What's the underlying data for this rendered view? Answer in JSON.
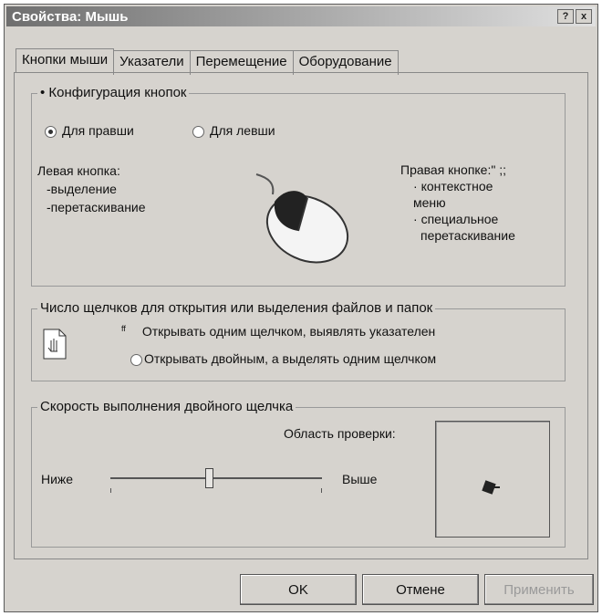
{
  "window": {
    "title": "Свойства: Мышь",
    "help": "?",
    "close": "x"
  },
  "tabs": [
    {
      "label": "Кнопки мыши"
    },
    {
      "label": "Указатели"
    },
    {
      "label": "Перемещение"
    },
    {
      "label": "Оборудование"
    }
  ],
  "buttons_group": {
    "legend": "Конфигурация кнопок",
    "right_handed": "Для правши",
    "left_handed": "Для левши",
    "left_button_title": "Левая кнопка:",
    "left_button_items": [
      "-выделение",
      "-перетаскивание"
    ],
    "right_button_title": "Правая кнопке:\"  ;;",
    "right_button_items": [
      "контекстное",
      "меню",
      "специальное",
      "перетаскивание"
    ]
  },
  "clicks_group": {
    "legend": "Число щелчков для открытия или выделения файлов и папок",
    "single": "Открывать одним щелчком, выявлять указателен",
    "double": "Открывать двойным, а выделять одним щелчком"
  },
  "speed_group": {
    "legend": "Скорость выполнения двойного щелчка",
    "test_area": "Область проверки:",
    "slow": "Ниже",
    "fast": "Выше",
    "speed_value": 0.46
  },
  "footer": {
    "ok": "OK",
    "cancel": "Отмене",
    "apply": "Применить"
  }
}
